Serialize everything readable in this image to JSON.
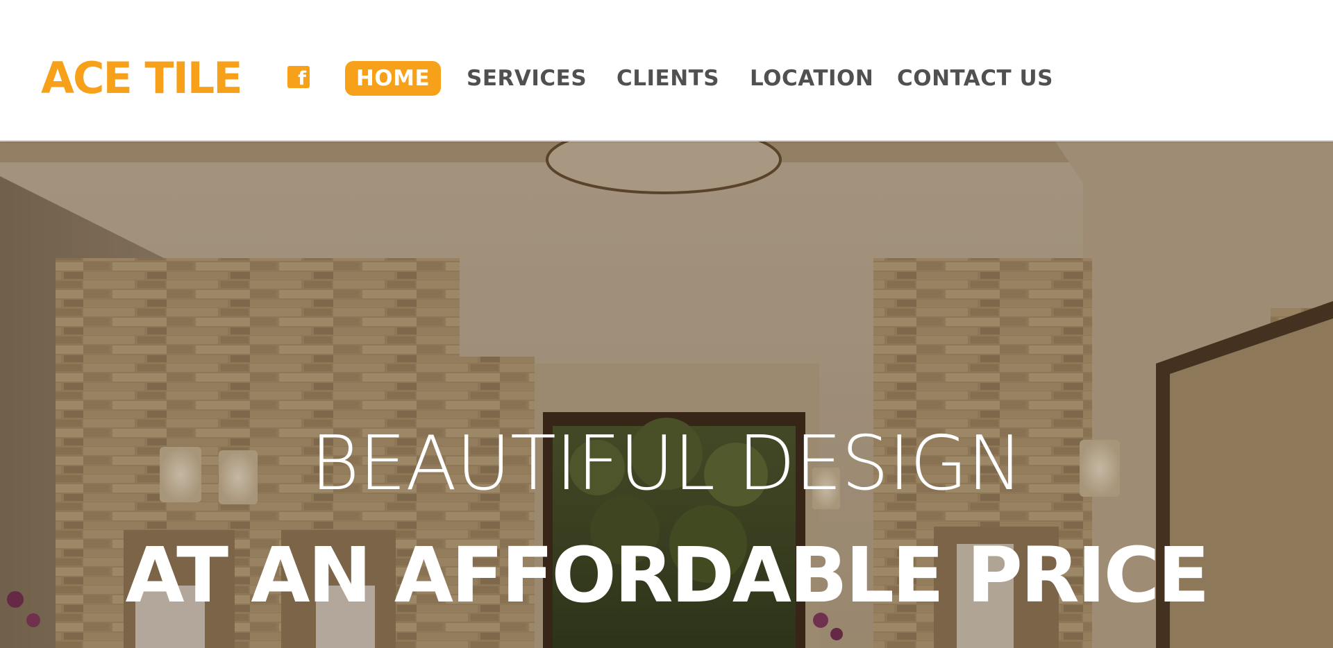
{
  "header": {
    "logo": "ACE TILE",
    "facebook_icon": "facebook-icon",
    "facebook_glyph": "f",
    "nav": {
      "home": "HOME",
      "services": "SERVICES",
      "clients": "CLIENTS",
      "location": "LOCATION",
      "contact": "CONTACT US"
    },
    "active_item": "HOME"
  },
  "hero": {
    "line1": "BEAUTIFUL DESIGN",
    "line2": "AT AN AFFORDABLE PRICE"
  },
  "colors": {
    "accent": "#f7a11a",
    "nav_text": "#505050",
    "hero_text": "#ffffff",
    "header_background": "#ffffff"
  }
}
